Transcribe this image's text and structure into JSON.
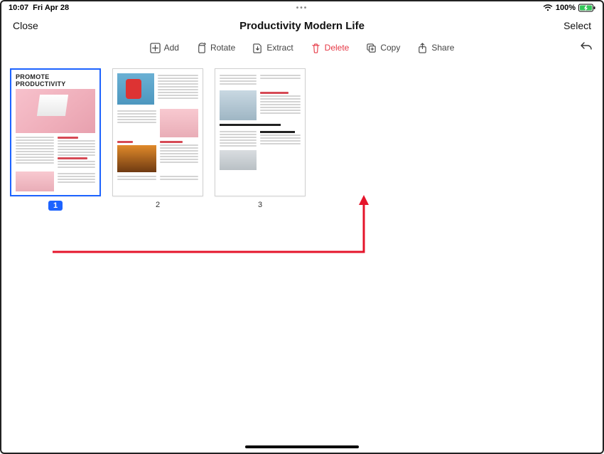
{
  "status": {
    "time": "10:07",
    "date": "Fri Apr 28",
    "battery": "100%",
    "charging": true
  },
  "header": {
    "close": "Close",
    "title": "Productivity Modern Life",
    "select": "Select"
  },
  "toolbar": {
    "add": "Add",
    "rotate": "Rotate",
    "extract": "Extract",
    "delete": "Delete",
    "copy": "Copy",
    "share": "Share"
  },
  "pages": {
    "selected_index": 0,
    "items": [
      {
        "number": "1",
        "title": "PROMOTE PRODUCTIVITY"
      },
      {
        "number": "2",
        "title": ""
      },
      {
        "number": "3",
        "title": ""
      }
    ]
  }
}
